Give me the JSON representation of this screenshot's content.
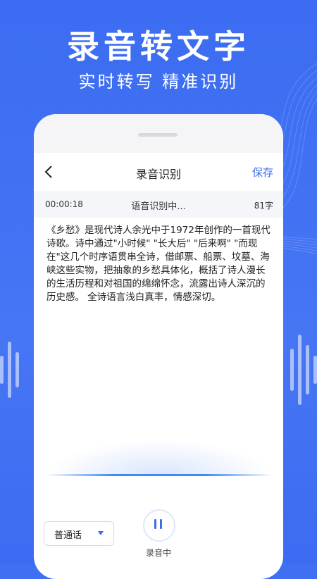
{
  "promo": {
    "headline": "录音转文字",
    "subline": "实时转写  精准识别"
  },
  "colors": {
    "brand_blue": "#3f6ff2",
    "accent": "#3b6ff0",
    "text": "#222222"
  },
  "nav": {
    "back_icon": "chevron-left-icon",
    "title": "录音识别",
    "save_label": "保存"
  },
  "status": {
    "elapsed": "00:00:18",
    "state": "语音识别中...",
    "char_count": "81字"
  },
  "transcript": "《乡愁》是现代诗人余光中于1972年创作的一首现代诗歌。诗中通过\"小时候\" \"长大后\" \"后来啊\" \"而现在\"这几个时序语贯串全诗，借邮票、船票、坟墓、海峡这些实物，把抽象的乡愁具体化，概括了诗人漫长的生活历程和对祖国的绵绵怀念，流露出诗人深沉的历史感。 全诗语言浅白真率，情感深切。",
  "controls": {
    "language": "普通话",
    "dropdown_icon": "caret-down-icon",
    "record_icon": "pause-icon",
    "record_label": "录音中"
  }
}
